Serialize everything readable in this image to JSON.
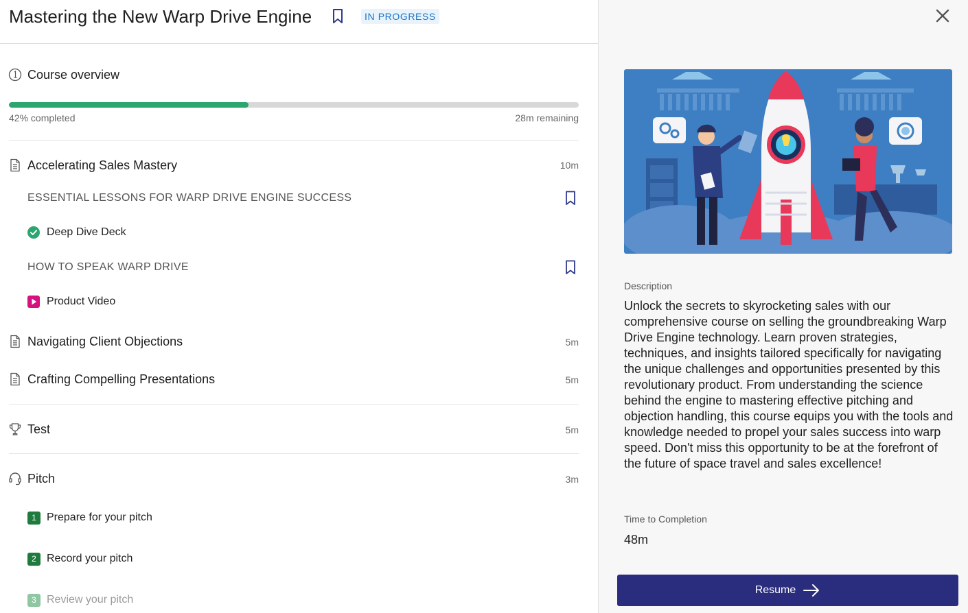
{
  "header": {
    "title": "Mastering the New Warp Drive Engine",
    "status": "IN PROGRESS",
    "bookmark_icon": "bookmark-icon",
    "close_icon": "close-icon"
  },
  "overview": {
    "title": "Course overview",
    "icon": "info-circle-icon",
    "progress_fraction": 0.42,
    "progress_text": "42% completed",
    "remaining_text": "28m remaining"
  },
  "modules": [
    {
      "title": "Accelerating Sales Mastery",
      "duration": "10m",
      "icon": "document-icon",
      "sections": [
        {
          "label": "ESSENTIAL LESSONS FOR WARP DRIVE ENGINE SUCCESS",
          "item": "Deep Dive Deck",
          "item_icon": "check-circle-icon"
        },
        {
          "label": "HOW TO SPEAK WARP DRIVE",
          "item": "Product Video",
          "item_icon": "play-icon"
        }
      ]
    },
    {
      "title": "Navigating Client Objections",
      "duration": "5m",
      "icon": "document-icon"
    },
    {
      "title": "Crafting Compelling Presentations",
      "duration": "5m",
      "icon": "document-icon"
    },
    {
      "title": "Test",
      "duration": "5m",
      "icon": "trophy-icon"
    },
    {
      "title": "Pitch",
      "duration": "3m",
      "icon": "headset-icon",
      "steps": [
        {
          "num": "1",
          "label": "Prepare for your pitch"
        },
        {
          "num": "2",
          "label": "Record your pitch"
        },
        {
          "num": "3",
          "label": "Review your pitch"
        }
      ]
    }
  ],
  "detail": {
    "description_label": "Description",
    "description": "Unlock the secrets to skyrocketing sales with our comprehensive course on selling the groundbreaking Warp Drive Engine technology. Learn proven strategies, techniques, and insights tailored specifically for navigating the unique challenges and opportunities presented by this revolutionary product. From understanding the science behind the engine to mastering effective pitching and objection handling, this course equips you with the tools and knowledge needed to propel your sales success into warp speed. Don't miss this opportunity to be at the forefront of the future of space travel and sales excellence!",
    "time_label": "Time to Completion",
    "time_value": "48m",
    "resume_label": "Resume",
    "resume_icon": "arrow-right-icon"
  },
  "colors": {
    "accent": "#2a2c7d",
    "progress": "#2aa66e",
    "badge_bg": "#e8f3fc",
    "badge_text": "#1c74c4",
    "video": "#d4137e",
    "hero_bg": "#3d7fc2"
  }
}
